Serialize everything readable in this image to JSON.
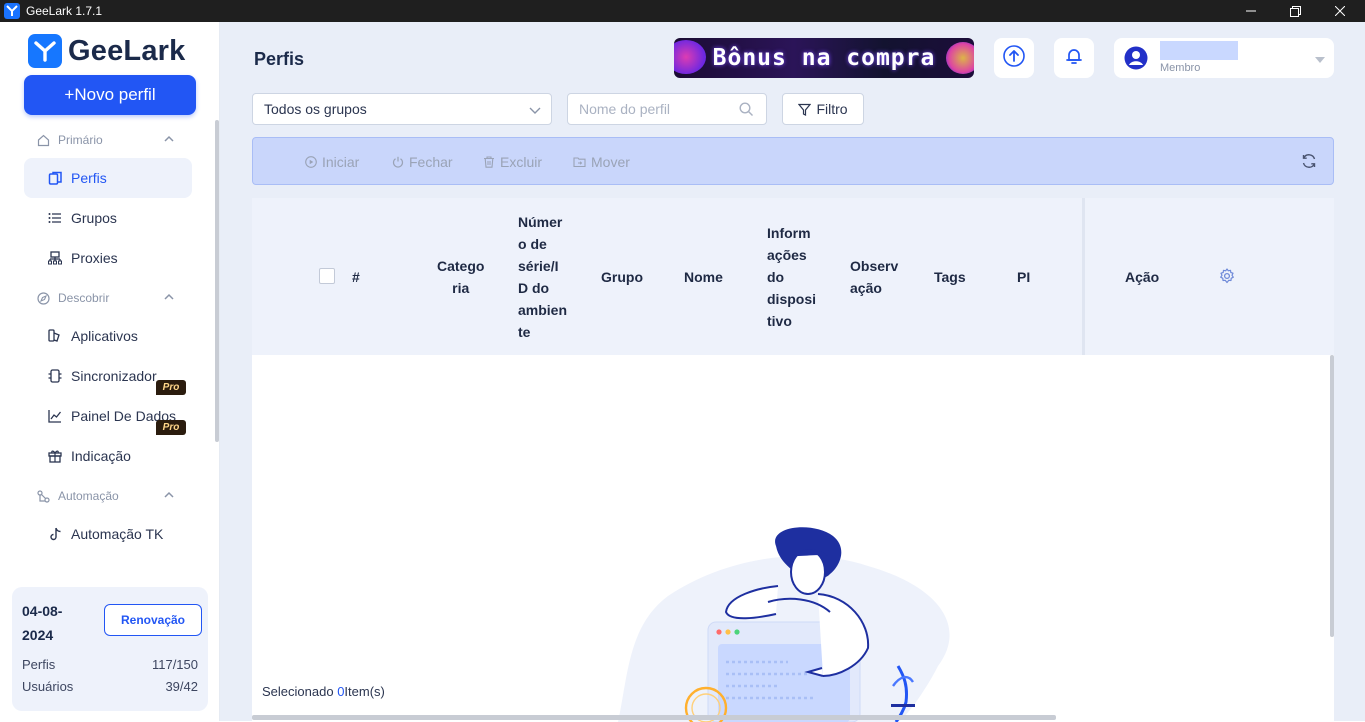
{
  "window": {
    "title": "GeeLark 1.7.1",
    "minimize_icon": "minimize-icon",
    "restore_icon": "restore-icon",
    "close_icon": "close-icon"
  },
  "brand": {
    "name": "GeeLark",
    "accent": "#2256f4"
  },
  "sidebar": {
    "new_profile": "+Novo perfil",
    "sections": {
      "primary": {
        "label": "Primário",
        "icon": "home-icon"
      },
      "discover": {
        "label": "Descobrir",
        "icon": "compass-icon"
      },
      "automation": {
        "label": "Automação",
        "icon": "automation-icon"
      }
    },
    "items": {
      "profiles": {
        "label": "Perfis",
        "icon": "profiles-icon"
      },
      "groups": {
        "label": "Grupos",
        "icon": "list-icon"
      },
      "proxies": {
        "label": "Proxies",
        "icon": "network-icon"
      },
      "apps": {
        "label": "Aplicativos",
        "icon": "apps-icon"
      },
      "sync": {
        "label": "Sincronizador",
        "icon": "sync-icon",
        "badge": "Pro"
      },
      "dashboard": {
        "label": "Painel De Dados",
        "icon": "chart-icon",
        "badge": "Pro"
      },
      "referral": {
        "label": "Indicação",
        "icon": "gift-icon"
      },
      "tk": {
        "label": "Automação TK",
        "icon": "tiktok-icon"
      }
    },
    "plan": {
      "date": "04-08-2024",
      "renew": "Renovação",
      "profiles_label": "Perfis",
      "profiles_value": "117/150",
      "users_label": "Usuários",
      "users_value": "39/42"
    }
  },
  "header": {
    "title": "Perfis",
    "banner": "Bônus na compra",
    "upload_icon": "upload-icon",
    "bell_icon": "bell-icon",
    "user": {
      "role": "Membro"
    }
  },
  "filters": {
    "group_select": "Todos os grupos",
    "search_placeholder": "Nome do perfil",
    "filter_label": "Filtro"
  },
  "toolbar": {
    "start": "Iniciar",
    "close": "Fechar",
    "delete": "Excluir",
    "move": "Mover"
  },
  "table": {
    "columns": {
      "num": "#",
      "category": "Catego\nria",
      "serial": "Númer\no de\nsérie/I\nD do\nambien\nte",
      "group": "Grupo",
      "name": "Nome",
      "device": "Inform\nações\ndo\ndisposi\ntivo",
      "notes": "Observ\nação",
      "tags": "Tags",
      "ip": "PI",
      "action": "Ação"
    },
    "selected_prefix": "Selecionado",
    "selected_count": "0",
    "selected_suffix": "Item(s)"
  }
}
